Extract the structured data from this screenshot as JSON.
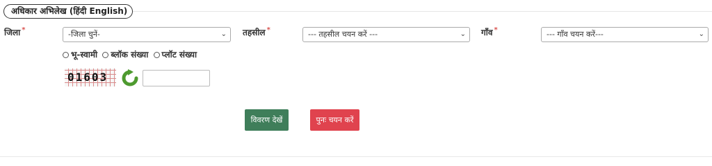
{
  "tab": {
    "label": "अधिकार अभिलेख  (हिंदी  English)"
  },
  "fields": {
    "district": {
      "label": "जिला",
      "required_mark": "*",
      "value": "-जिला चुनें-"
    },
    "tehsil": {
      "label": "तहसील",
      "required_mark": "*",
      "value": "--- तहसील चयन करें ---"
    },
    "village": {
      "label": "गाँव",
      "required_mark": "*",
      "value": "--- गाँव चयन करें---"
    }
  },
  "search_options": [
    {
      "label": "भू-स्वामी",
      "selected": false
    },
    {
      "label": "ब्लॉक संख्या",
      "selected": false
    },
    {
      "label": "प्लॉट संख्या",
      "selected": false
    }
  ],
  "captcha": {
    "code": "01603",
    "input_value": ""
  },
  "buttons": {
    "view": "विवरण देखें",
    "reset": "पुनः चयन करें"
  },
  "colors": {
    "view_button": "#3f7e5a",
    "reset_button": "#e0434e",
    "required": "#d9534f"
  },
  "icons": {
    "dropdown": "chevron-down-icon",
    "refresh": "refresh-icon"
  }
}
